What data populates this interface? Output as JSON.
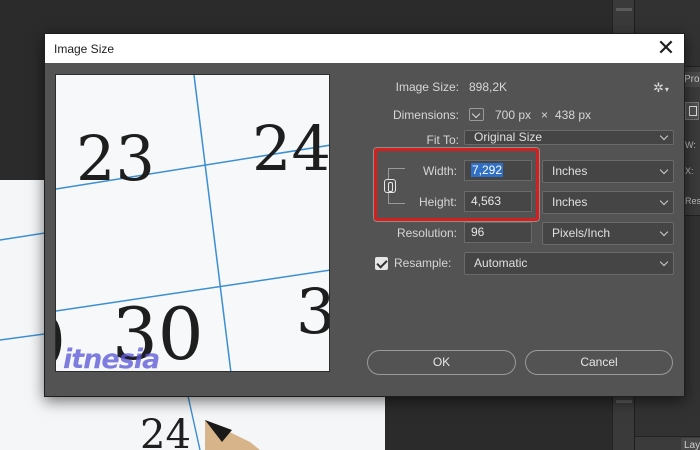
{
  "dialog": {
    "title": "Image Size",
    "close_glyph": "✕",
    "gear_glyph": "✲",
    "image_size_label": "Image Size:",
    "image_size_value": "898,2K",
    "dimensions_label": "Dimensions:",
    "dim_width": "700 px",
    "dim_sep": "×",
    "dim_height": "438 px",
    "fit_to_label": "Fit To:",
    "fit_to_value": "Original Size",
    "width_label": "Width:",
    "width_value": "7,292",
    "width_unit": "Inches",
    "height_label": "Height:",
    "height_value": "4,563",
    "height_unit": "Inches",
    "resolution_label": "Resolution:",
    "resolution_value": "96",
    "resolution_unit": "Pixels/Inch",
    "resample_label": "Resample:",
    "resample_value": "Automatic",
    "ok_label": "OK",
    "cancel_label": "Cancel"
  },
  "preview": {
    "numbers": [
      "23",
      "24",
      "30",
      "3"
    ],
    "watermark": "itnesia"
  },
  "canvas": {
    "numbers": [
      "24"
    ]
  },
  "right_panel": {
    "tab_properties": "Pro",
    "tab_layers": "Lay",
    "w_label": "W:",
    "x_label": "X:",
    "res_label": "Res"
  },
  "colors": {
    "highlight": "#d51e1e",
    "selection": "#2f6fc6",
    "watermark": "#5e5ad8",
    "grid_lines": "#3c8fd0"
  },
  "icons": {
    "close": "close-icon",
    "gear": "gear-icon",
    "link": "chain-link-icon",
    "checkbox": "checkmark-icon",
    "dropdown": "chevron-down-icon"
  }
}
